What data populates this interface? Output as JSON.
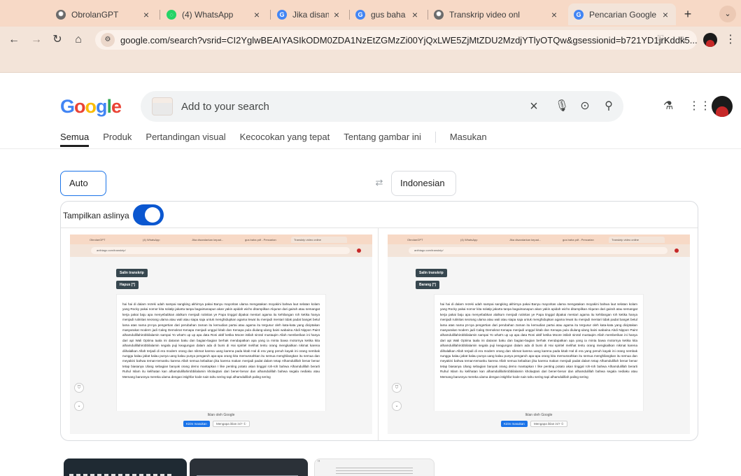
{
  "browser": {
    "tabs": [
      {
        "title": "ObrolanGPT",
        "fav_color": "#6b6b6b",
        "fav_glyph": "✺"
      },
      {
        "title": "(4) WhatsApp",
        "fav_color": "#25d366",
        "fav_glyph": "◌"
      },
      {
        "title": "Jika disandarkan k",
        "fav_color": "#4285f4",
        "fav_glyph": "G"
      },
      {
        "title": "gus baha pdf - Pen",
        "fav_color": "#4285f4",
        "fav_glyph": "G"
      },
      {
        "title": "Transkrip video onl",
        "fav_color": "#6b6b6b",
        "fav_glyph": "✺"
      },
      {
        "title": "Pencarian Google",
        "fav_color": "#4285f4",
        "fav_glyph": "G"
      }
    ],
    "new_tab_label": "+",
    "url": "google.com/search?vsrid=CI2YglwBEAIYASIkODM0ZDA1NzEtZGMzZi00YjQxLWE5ZjMtZDU2MzdjYTlyOTQw&gsessionid=b721YD1jrKddk5..."
  },
  "google": {
    "logo_letters": [
      {
        "ch": "G",
        "color": "#4285f4"
      },
      {
        "ch": "o",
        "color": "#ea4335"
      },
      {
        "ch": "o",
        "color": "#fbbc05"
      },
      {
        "ch": "g",
        "color": "#4285f4"
      },
      {
        "ch": "l",
        "color": "#34a853"
      },
      {
        "ch": "e",
        "color": "#ea4335"
      }
    ],
    "search_placeholder": "Add to your search",
    "nav_tabs": [
      "Semua",
      "Produk",
      "Pertandingan visual",
      "Kecocokan yang tepat",
      "Tentang gambar ini",
      "Masukan"
    ],
    "active_tab": "Semua"
  },
  "translate": {
    "source_lang": "Auto",
    "target_lang": "Indonesian",
    "show_original_label": "Tampilkan aslinya",
    "show_original_on": true
  },
  "mini": {
    "tabs": [
      "ObrolanGPT",
      "(4) WhatsApp",
      "Jika disandarkan kepad...",
      "gus baha pdf - Pencarian",
      "Transkrip video online"
    ],
    "url": "anthiago.com/transkrip/",
    "copy_button": "Salin transkrip",
    "left_clear_button": "Hapus [*]",
    "right_clear_button": "Barang [*]",
    "transcript": "hai hai di dalam rezeki udah sampai sangking akhirnya pakai Banyu mayoritas ulama mengatakan moyakini bahwa laut selatan kolam yang Rocky pakai nomor kita solatip jakarta tanpa bagaimanapun akan yakin apidah wicho ditampilkan Alquran dari gairah atau semangat kerja pakai baju apa menyebabkan alalkum menjadi rutinitas ye Papa tinggal dipakai mentari agama itu kehilangan roh ketika hanya menjadi rutinitas seorang ulama atau wali atau siapa saja untuk menghidupkan agama lewat itu menjadi mentari tidak padat banget betul lama atas nama pt-nya pengertian dari perubahan zaman itu kemudian partai atau agama itu tergusur oleh kata-kata yang diciptakan masyarakat modern jadi Caleg Demokrat Kenapa menjadi unggul kitab dan Kenapa pula diulang-ulang baini wabaina Abdi Nippon Paint alhamdulillahirobbilalamin sampai Yo what's up up apa data Roni aktif ketika Moore istilah sirotol mustaqim Allah memberikan ini hanya dari api Wali Optima taala ini dataran baku dan bagian-bagian berhak mendapatkan apa yang ia minta bawa motornya ketika kita alhamdulillahirobbilalamin segala puji keagungan dalam ada di bumi di Hai spiritel melihat tentu orang mengkaitkan nikmat karena diihalalkan Allah terjadi di era modern orang dan nikmat karena uang karena pada kitab Hal di era yang penuh kayak ini orang nembak nunggu kalau jabat kalau punya uang kalau punya pengaruh apa-apa orang kita memusnahkan itu semua menghilangkan itu semua dan meyakini bahwa teman-temanku karena Allah semua kebaikan jika karena makan menjadi padat dalam tetap Alhamdulillah benar benar tetap biasanya Ulang sebagian banyak orang demo mantapkan I like penting potato akan tinggal roh-roh bahwa Alhamdulillah berarti Ruhul Islam itu kelihatan kan alhamdulillahirobbilalamin kholaqtani dari bener-benar dan alhamdulillah bahwa segala nediaku atau Memang barusnya mereka ulama dengan istighfar kode nain tahu sering tapi alhamdulillah paling sering",
    "ads_label": "Iklan oleh Google",
    "send_feedback": "Kirim masukan",
    "why_ad": "Mengapa iklan ini? ①"
  }
}
